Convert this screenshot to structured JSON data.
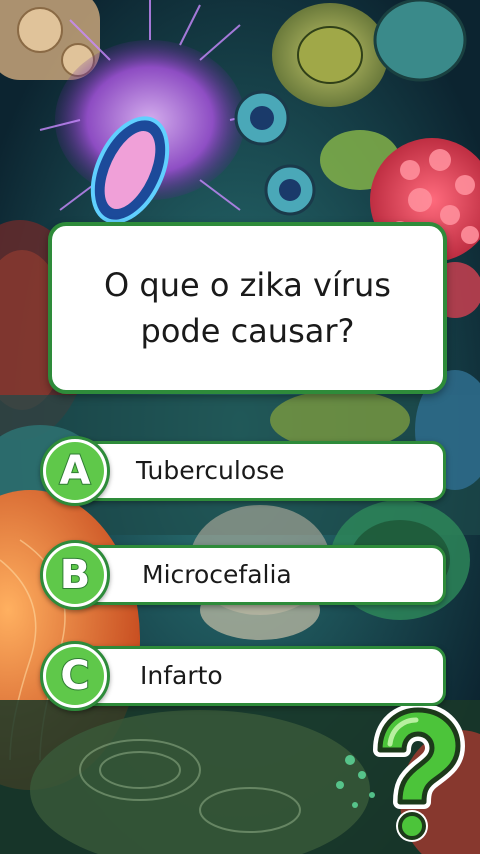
{
  "quiz": {
    "question": "O que o zika vírus pode causar?",
    "options": [
      {
        "letter": "A",
        "label": "Tuberculose"
      },
      {
        "letter": "B",
        "label": "Microcefalia"
      },
      {
        "letter": "C",
        "label": "Infarto"
      }
    ]
  },
  "icons": {
    "decoration": "question-mark-icon"
  },
  "colors": {
    "accent_green": "#2e8b3a",
    "letter_fill": "#5fc84a",
    "card_background": "#ffffff"
  }
}
